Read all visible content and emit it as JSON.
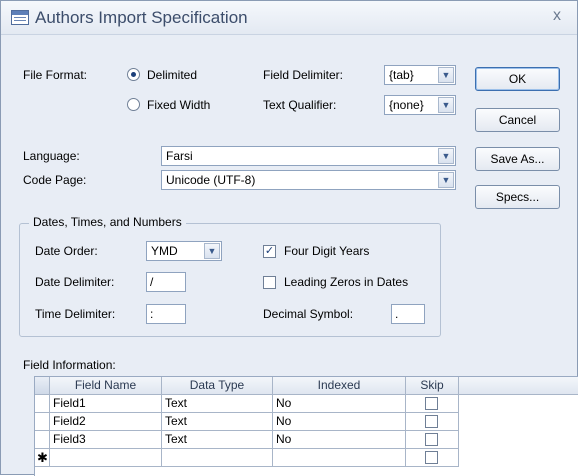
{
  "window": {
    "title": "Authors Import Specification",
    "close_glyph": "x"
  },
  "file_format": {
    "label": "File Format:",
    "options": [
      {
        "label": "Delimited",
        "selected": true
      },
      {
        "label": "Fixed Width",
        "selected": false
      }
    ]
  },
  "field_delimiter": {
    "label": "Field Delimiter:",
    "value": "{tab}"
  },
  "text_qualifier": {
    "label": "Text Qualifier:",
    "value": "{none}"
  },
  "language": {
    "label": "Language:",
    "value": "Farsi"
  },
  "code_page": {
    "label": "Code Page:",
    "value": "Unicode (UTF-8)"
  },
  "buttons": {
    "ok": "OK",
    "cancel": "Cancel",
    "save_as": "Save As...",
    "specs": "Specs..."
  },
  "dates_group": {
    "title": "Dates, Times, and Numbers",
    "date_order_label": "Date Order:",
    "date_order_value": "YMD",
    "date_delimiter_label": "Date Delimiter:",
    "date_delimiter_value": "/",
    "time_delimiter_label": "Time Delimiter:",
    "time_delimiter_value": ":",
    "four_digit_years_label": "Four Digit Years",
    "four_digit_years_checked": true,
    "leading_zeros_label": "Leading Zeros in Dates",
    "leading_zeros_checked": false,
    "decimal_symbol_label": "Decimal Symbol:",
    "decimal_symbol_value": "."
  },
  "field_info": {
    "label": "Field Information:",
    "columns": [
      "Field Name",
      "Data Type",
      "Indexed",
      "Skip"
    ],
    "rows": [
      {
        "name": "Field1",
        "type": "Text",
        "indexed": "No",
        "skip": false
      },
      {
        "name": "Field2",
        "type": "Text",
        "indexed": "No",
        "skip": false
      },
      {
        "name": "Field3",
        "type": "Text",
        "indexed": "No",
        "skip": false
      }
    ],
    "new_row_glyph": "✱"
  },
  "colors": {
    "title_text": "#3c4d6b",
    "dialog_bg": "#e8edf5",
    "accent": "#1c3f7a"
  }
}
